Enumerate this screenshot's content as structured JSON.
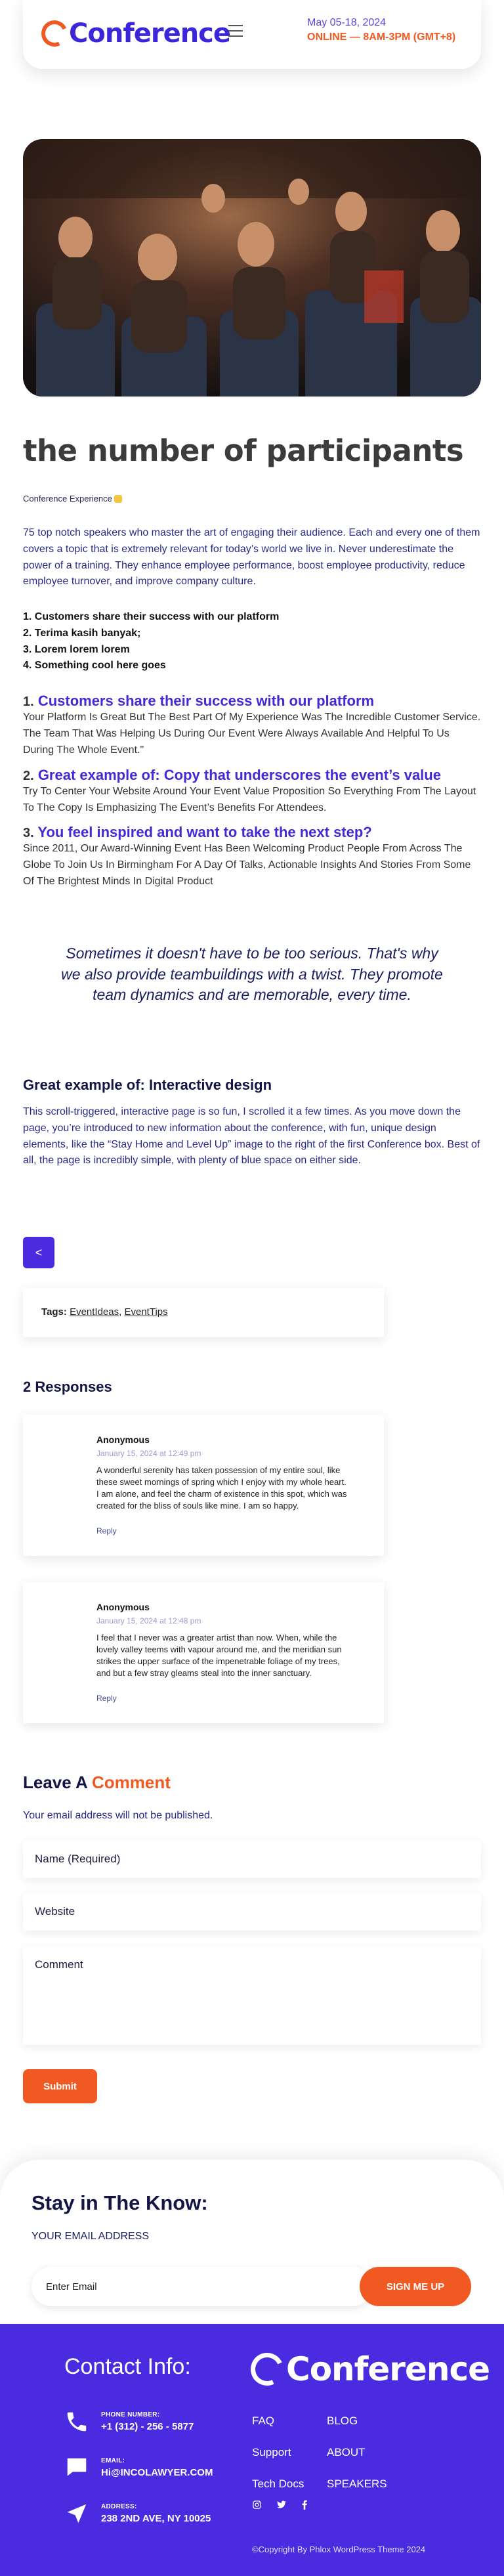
{
  "header": {
    "logo_text": "Conference",
    "date_line": "May 05-18, 2024",
    "online_line": "ONLINE — 8AM-3PM (GMT+8)"
  },
  "post": {
    "title": "the number of participants",
    "category": "Conference Experience",
    "intro": "75 top notch speakers who master the art of engaging their audience. Each and every one of them covers a topic that is extremely relevant for today’s world we live in. Never underestimate the power of a training. They enhance employee performance, boost employee productivity, reduce employee turnover, and improve company culture.",
    "list": [
      "1. Customers share their success with our platform",
      "2. Terima kasih banyak;",
      "3. Lorem lorem lorem",
      "4. Something cool here goes"
    ],
    "sections": [
      {
        "num": "1.",
        "heading": "Customers share their success with our platform",
        "body": "Your Platform Is Great But The Best Part Of My Experience Was The Incredible Customer Service. The Team That Was Helping Us During Our Event Were Always Available And Helpful To Us During The Whole Event.\""
      },
      {
        "num": "2.",
        "heading": "Great example of: Copy that underscores the event’s value",
        "body": "Try To Center Your Website Around Your Event Value Proposition So Everything From The Layout To The Copy Is Emphasizing The Event’s Benefits For Attendees."
      },
      {
        "num": "3.",
        "heading": "You feel inspired and want to take the next step?",
        "body": "Since 2011, Our Award-Winning Event Has Been Welcoming Product People From Across The Globe To Join Us In Birmingham For A Day Of Talks, Actionable Insights And Stories From Some Of The Brightest Minds In Digital Product"
      }
    ],
    "quote": "Sometimes it doesn't have to be too serious. That's why we also provide teambuildings with a twist. They promote team dynamics and are memorable, every time.",
    "subheading": "Great example of: Interactive design",
    "sub_body": "This scroll-triggered, interactive page is so fun, I scrolled it a few times. As you move down the page, you’re introduced to new information about the conference, with fun, unique design elements, like the “Stay Home and Level Up” image to the right of the first Conference box. Best of all, the page is incredibly simple, with plenty of blue space on either side.",
    "share_icon": "share-icon",
    "tags_label": "Tags:",
    "tags": [
      "EventIdeas",
      "EventTips"
    ]
  },
  "responses": {
    "heading": "2 Responses",
    "items": [
      {
        "name": "Anonymous",
        "date": "January 15, 2024 at 12:49 pm",
        "text": "A wonderful serenity has taken possession of my entire soul, like these sweet mornings of spring which I enjoy with my whole heart. I am alone, and feel the charm of existence in this spot, which was created for the bliss of souls like mine. I am so happy.",
        "reply": "Reply"
      },
      {
        "name": "Anonymous",
        "date": "January 15, 2024 at 12:48 pm",
        "text": "I feel that I never was a greater artist than now. When, while the lovely valley teems with vapour around me, and the meridian sun strikes the upper surface of the impenetrable foliage of my trees, and but a few stray gleams steal into the inner sanctuary.",
        "reply": "Reply"
      }
    ]
  },
  "form": {
    "heading_a": "Leave A ",
    "heading_b": "Comment",
    "note": "Your email address will not be published.",
    "name_placeholder": "Name (Required)",
    "website_placeholder": "Website",
    "comment_placeholder": "Comment",
    "submit": "Submit"
  },
  "newsletter": {
    "heading": "Stay in The Know:",
    "label": "YOUR EMAIL ADDRESS",
    "placeholder": "Enter Email",
    "button": "SIGN ME UP"
  },
  "footer": {
    "contact_heading": "Contact Info:",
    "contacts": [
      {
        "icon": "phone-icon",
        "key": "PHONE NUMBER:",
        "value": "+1 (312) - 256 - 5877"
      },
      {
        "icon": "chat-icon",
        "key": "EMAIL:",
        "value": "Hi@INCOLAWYER.COM"
      },
      {
        "icon": "navigation-icon",
        "key": "ADDRESS:",
        "value": "238 2ND AVE, NY 10025"
      }
    ],
    "logo_text": "Conference",
    "links_col1": [
      "FAQ",
      "Support",
      "Tech Docs"
    ],
    "links_col2": [
      "BLOG",
      "ABOUT",
      "SPEAKERS"
    ],
    "social": [
      "instagram-icon",
      "twitter-icon",
      "facebook-icon"
    ],
    "copyright": "©Copyright By Phlox WordPress Theme 2024"
  }
}
